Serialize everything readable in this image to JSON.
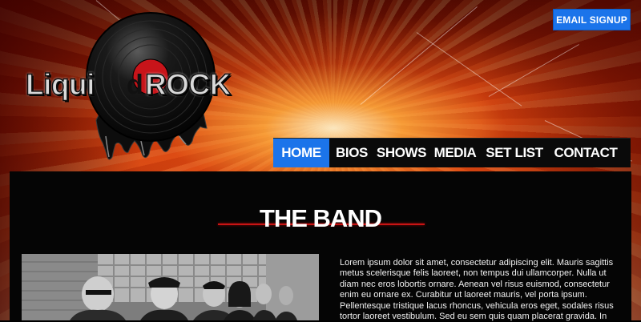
{
  "header": {
    "email_signup_label": "EMAIL SIGNUP",
    "logo_text_left": "Liqui",
    "logo_text_right": "ROCK",
    "logo_center_letter": "d"
  },
  "nav": {
    "items": [
      {
        "label": "HOME",
        "active": true
      },
      {
        "label": "BIOS",
        "active": false
      },
      {
        "label": "SHOWS",
        "active": false
      },
      {
        "label": "MEDIA",
        "active": false
      },
      {
        "label": "SET LIST",
        "active": false
      },
      {
        "label": "CONTACT",
        "active": false
      }
    ]
  },
  "main": {
    "title": "THE BAND",
    "body": "Lorem ipsum dolor sit amet, consectetur adipiscing elit. Mauris sagittis metus scelerisque felis laoreet, non tempus dui ullamcorper. Nulla ut diam nec eros lobortis ornare. Aenean vel risus euismod, consectetur enim eu ornare ex. Curabitur ut laoreet mauris, vel porta ipsum. Pellentesque tristique lacus rhoncus, vehicula eros eget, sodales risus tortor laoreet vestibulum. Sed eu sem quis quam placerat gravida. In"
  },
  "colors": {
    "accent": "#1b74ea",
    "title_rule": "#c81414",
    "panel": "#050505"
  }
}
